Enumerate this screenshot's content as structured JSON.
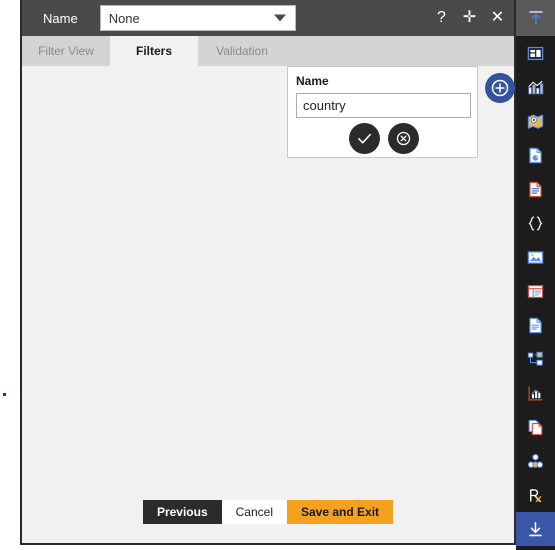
{
  "titlebar": {
    "label": "Name",
    "select_value": "None",
    "icons": [
      {
        "name": "help-icon",
        "glyph": "?"
      },
      {
        "name": "move-icon",
        "glyph": "✛"
      },
      {
        "name": "close-icon",
        "glyph": "✕"
      }
    ]
  },
  "tabs": [
    {
      "label": "Filter View",
      "active": false
    },
    {
      "label": "Filters",
      "active": true
    },
    {
      "label": "Validation",
      "active": false
    }
  ],
  "popup": {
    "label": "Name",
    "input_value": "country",
    "input_placeholder": "",
    "confirm_label": "✓",
    "cancel_label": "⊗"
  },
  "add_button": {
    "name": "add-filter-button",
    "glyph": "⊕"
  },
  "buttonbar": [
    {
      "label": "Previous",
      "style": "bb-prev",
      "name": "previous-button"
    },
    {
      "label": "Cancel",
      "style": "bb-cancel",
      "name": "cancel-button"
    },
    {
      "label": "Save and Exit",
      "style": "bb-save",
      "name": "save-and-exit-button"
    }
  ],
  "sidebar": {
    "top_icon": "collapse-up-icon",
    "items": [
      {
        "name": "dashboard-icon",
        "active": false
      },
      {
        "name": "bar-chart-icon",
        "active": false
      },
      {
        "name": "map-icon",
        "active": false
      },
      {
        "name": "report-document-icon",
        "active": false
      },
      {
        "name": "text-document-icon",
        "active": false
      },
      {
        "name": "code-braces-icon",
        "active": false
      },
      {
        "name": "image-icon",
        "active": false
      },
      {
        "name": "table-layout-icon",
        "active": false
      },
      {
        "name": "page-icon",
        "active": false
      },
      {
        "name": "hierarchy-icon",
        "active": false
      },
      {
        "name": "line-chart-icon",
        "active": false
      },
      {
        "name": "copy-pages-icon",
        "active": false
      },
      {
        "name": "molecule-icon",
        "active": false
      },
      {
        "name": "prescription-rx-icon",
        "active": false
      },
      {
        "name": "download-icon",
        "active": true
      }
    ]
  },
  "colors": {
    "titlebar_bg": "#4a4a4a",
    "tabstrip_bg": "#d4d4d4",
    "content_bg": "#f1f1f1",
    "sidebar_bg": "#1c1c1c",
    "accent_blue": "#34539f",
    "accent_orange": "#f5a11d",
    "dark_button": "#2b2b2b"
  }
}
